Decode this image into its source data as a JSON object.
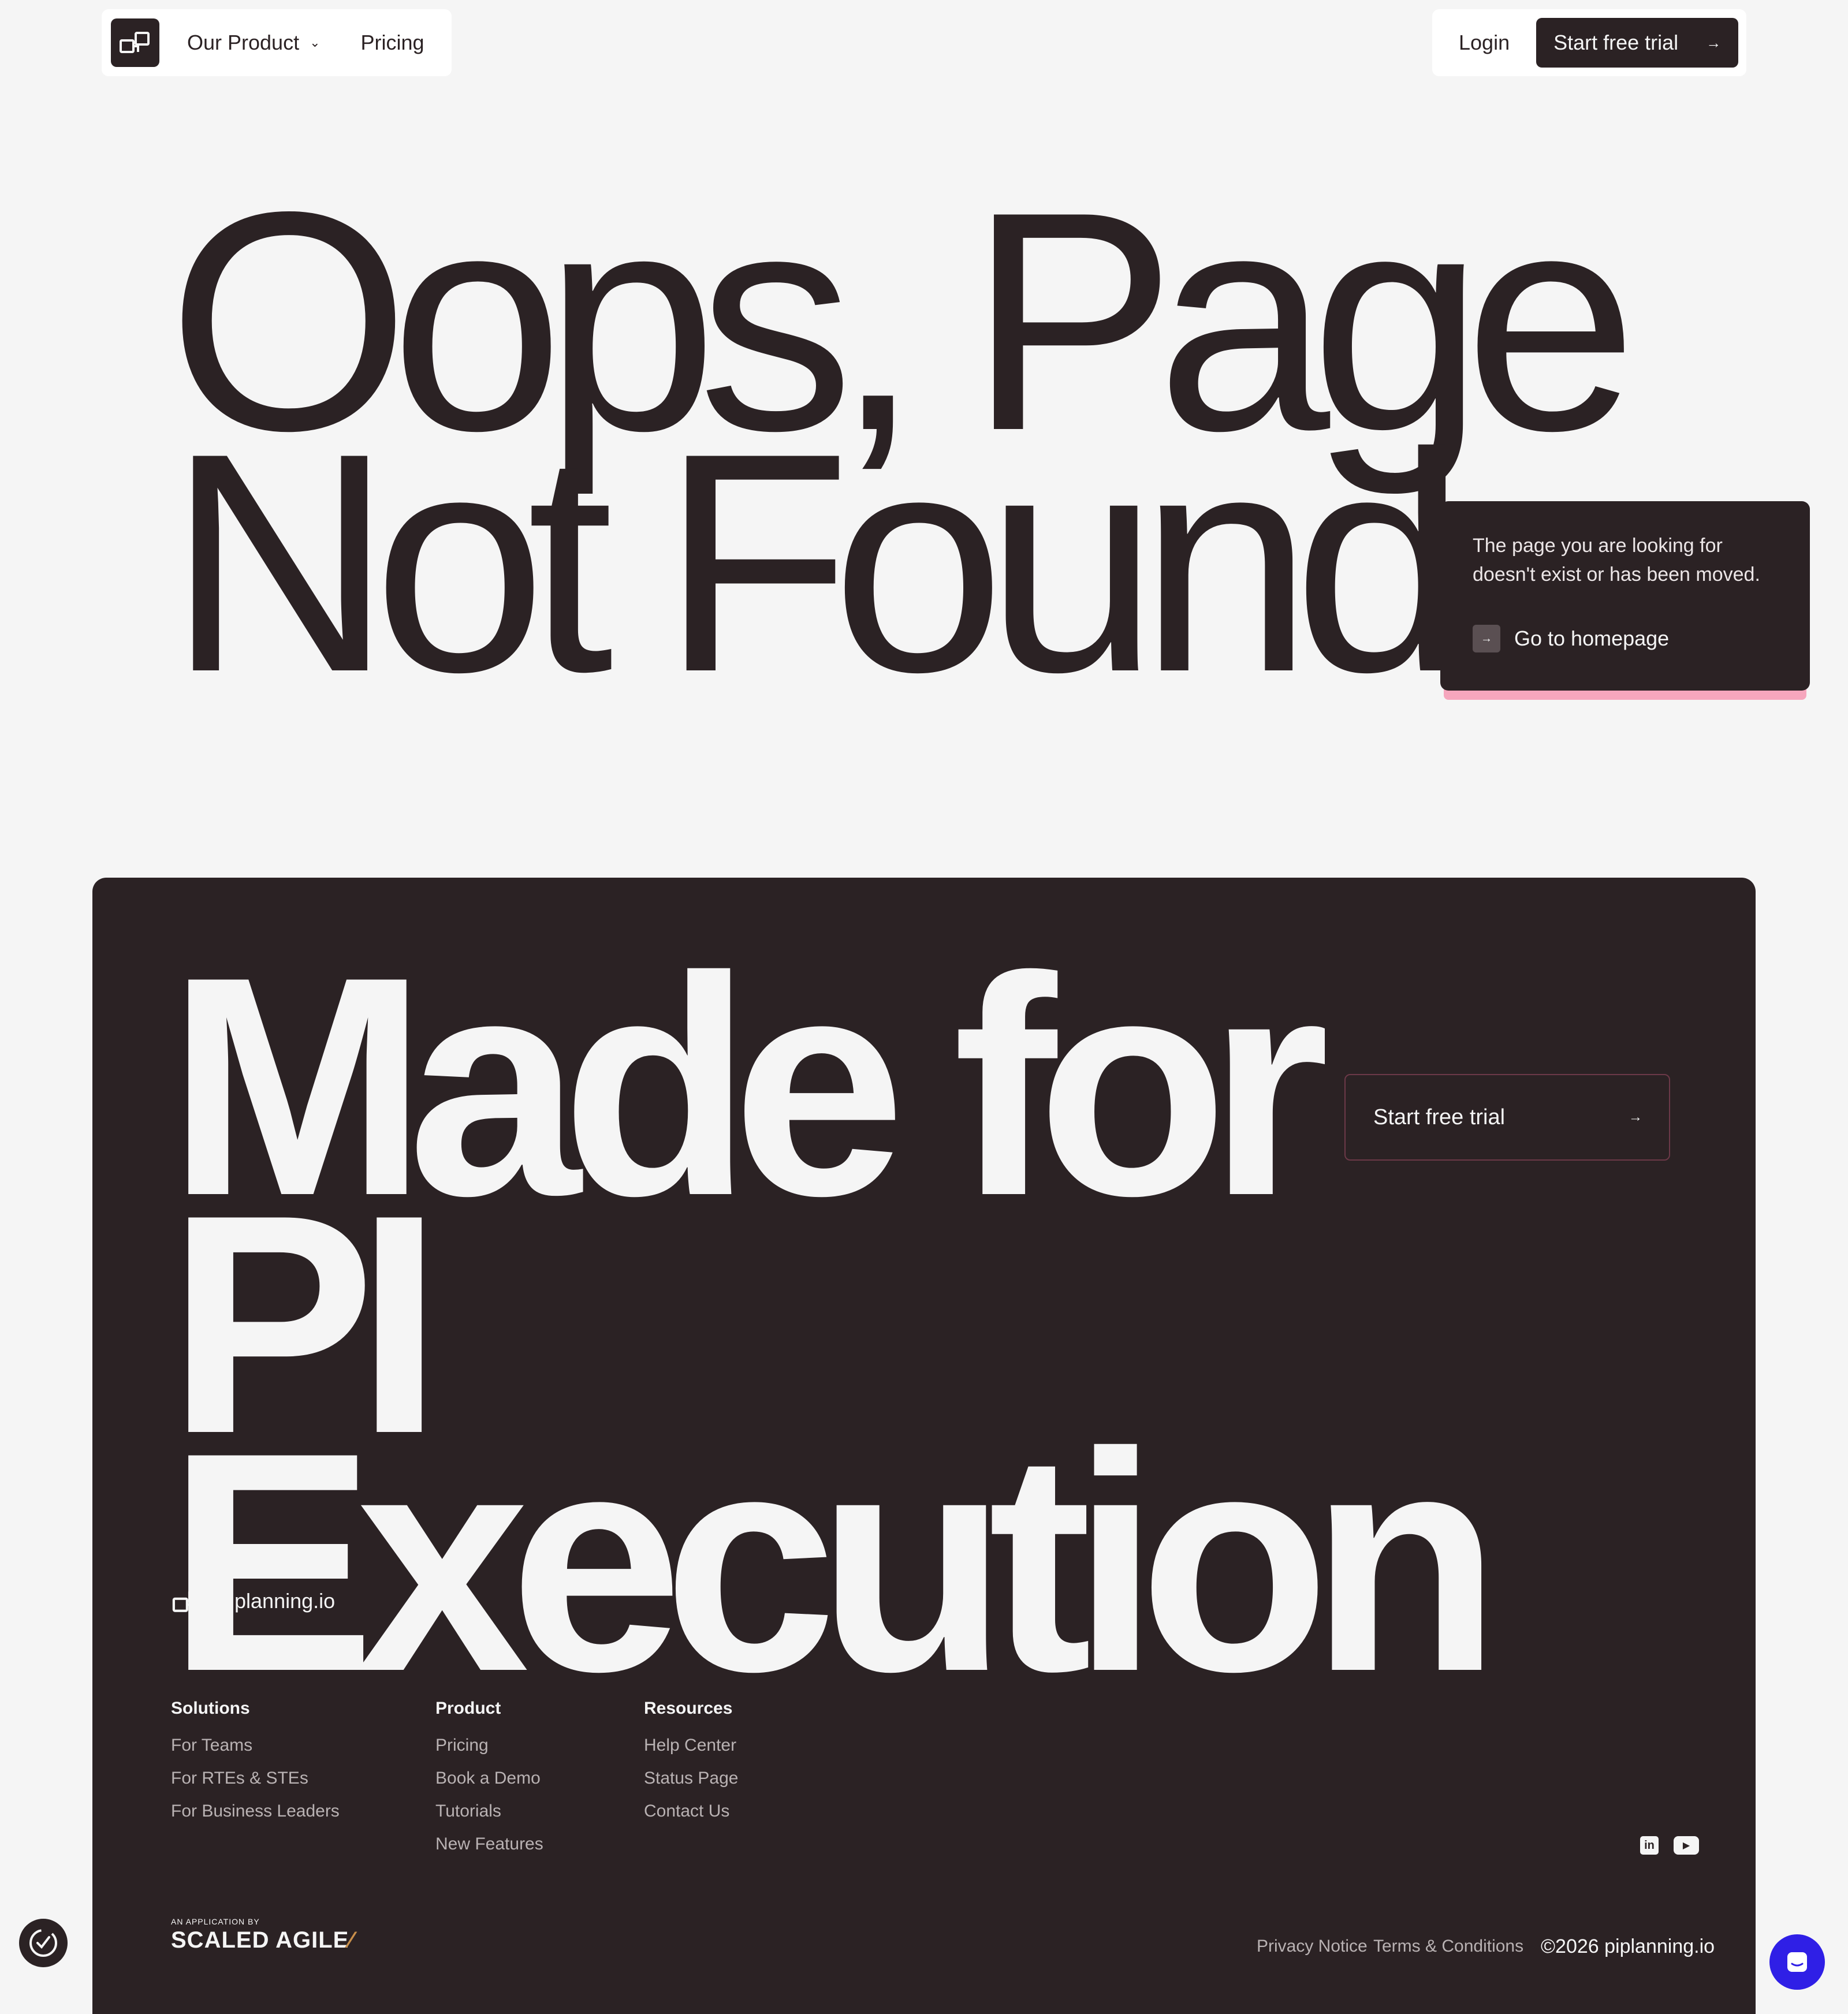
{
  "header": {
    "product_label": "Our Product",
    "pricing_label": "Pricing",
    "login_label": "Login",
    "trial_label": "Start free trial"
  },
  "hero": {
    "title": "Oops, Page\nNot Found",
    "message": "The page you are looking for doesn't exist or has been moved.",
    "homepage_link": "Go to homepage",
    "card_accent": "#f6a6bd"
  },
  "footer": {
    "title": "Made for\nPI Execution",
    "trial_label": "Start free trial",
    "brand_name": "piplanning.io",
    "columns": {
      "solutions": {
        "heading": "Solutions",
        "links": [
          "For Teams",
          "For RTEs & STEs",
          "For Business Leaders"
        ]
      },
      "product": {
        "heading": "Product",
        "links": [
          "Pricing",
          "Book a Demo",
          "Tutorials",
          "New Features"
        ]
      },
      "resources": {
        "heading": "Resources",
        "links": [
          "Help Center",
          "Status Page",
          "Contact Us"
        ]
      }
    },
    "application_by": "AN APPLICATION BY",
    "safe_name": "SCALED AGILE",
    "privacy": "Privacy Notice",
    "terms": "Terms & Conditions",
    "copyright": "©2026 piplanning.io"
  },
  "icons": {
    "arrow": "→",
    "chevron": "⌄",
    "linkedin": "in",
    "youtube": "▶"
  },
  "colors": {
    "dark": "#2b2224",
    "light": "#f5f5f5",
    "accent_pink": "#f6a6bd",
    "chat_blue": "#2f1fe6"
  }
}
